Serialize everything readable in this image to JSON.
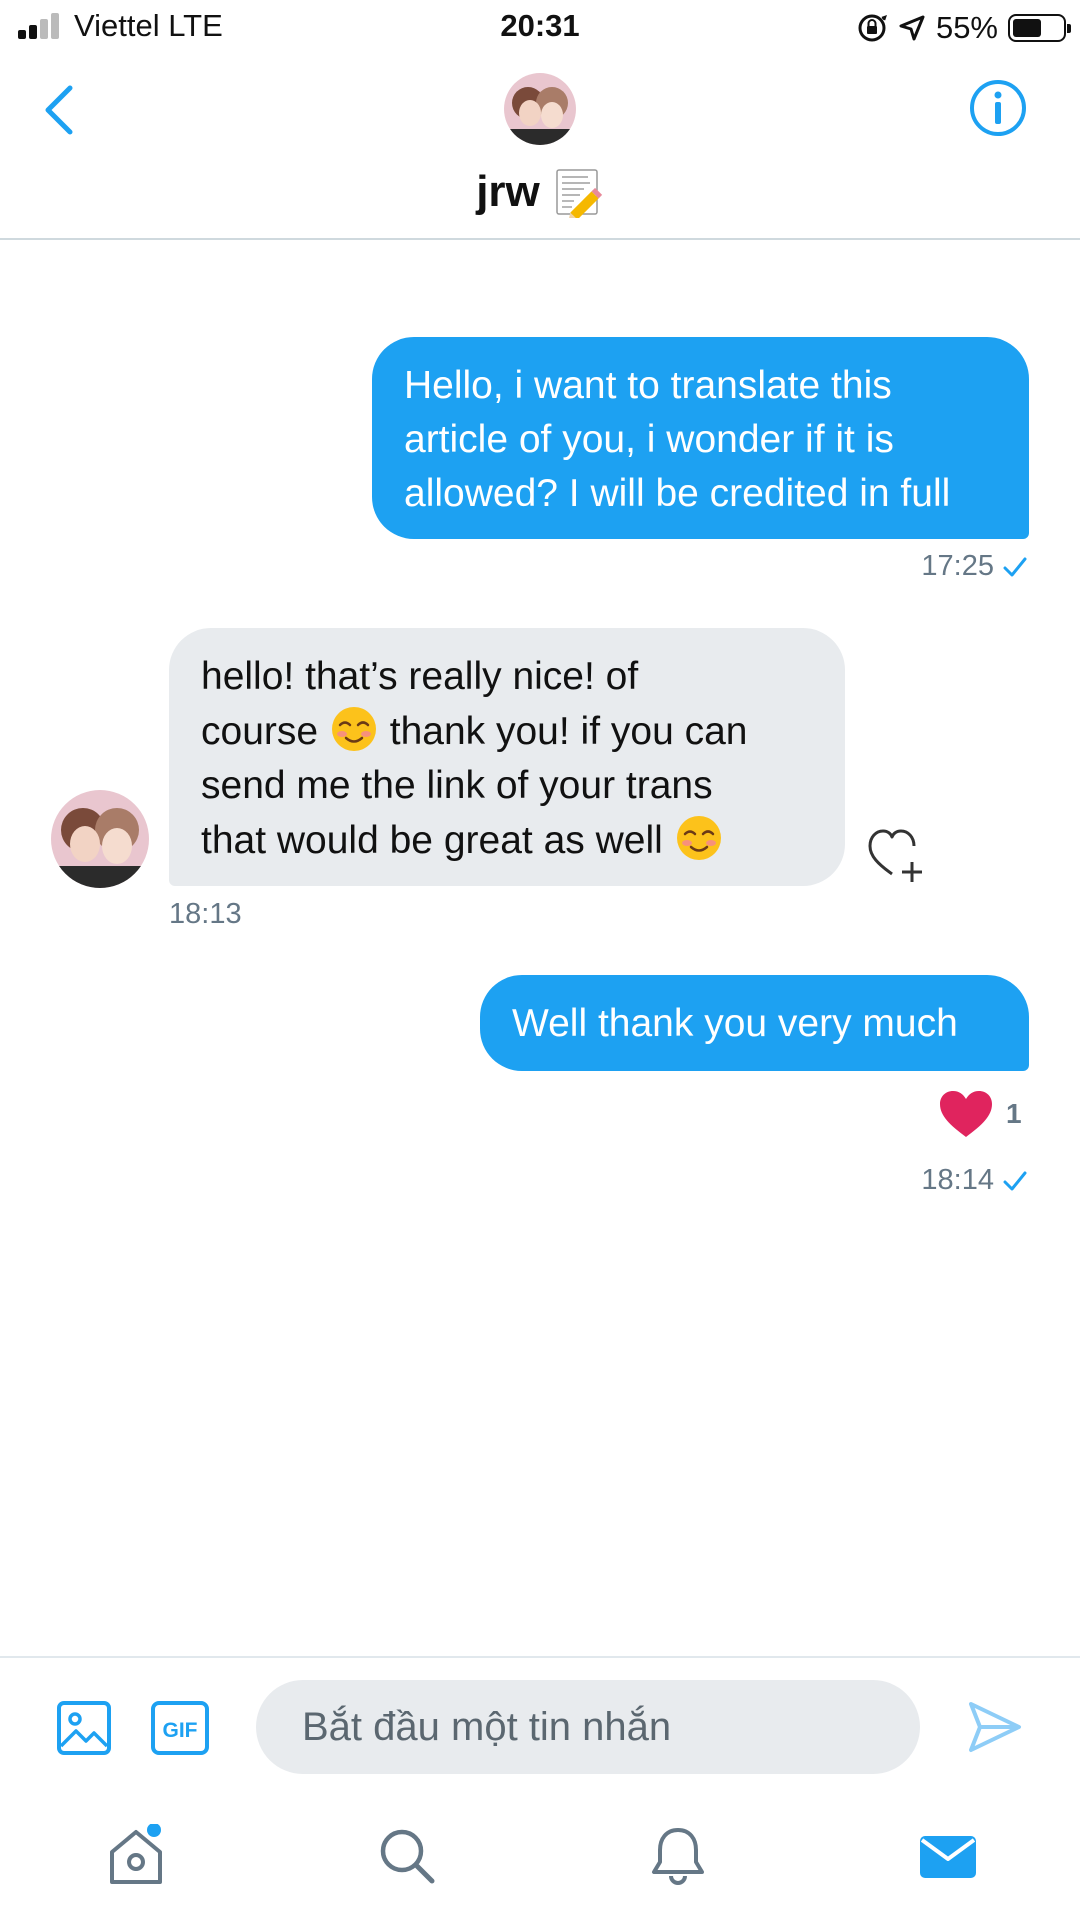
{
  "status_bar": {
    "carrier": "Viettel  LTE",
    "time": "20:31",
    "battery": "55%",
    "icons": [
      "signal-icon",
      "rotation-lock-icon",
      "location-icon",
      "battery-icon"
    ]
  },
  "header": {
    "name": "jrw",
    "name_emoji": "memo-icon",
    "back_icon": "chevron-left-icon",
    "info_icon": "info-icon"
  },
  "messages": [
    {
      "direction": "outgoing",
      "lines": [
        "Hello, i want to translate this",
        "article of you, i wonder if it is",
        "allowed? I will be credited in full"
      ],
      "time": "17:25",
      "status": "sent"
    },
    {
      "direction": "incoming",
      "lines": [
        "hello! that’s really nice! of",
        "course",
        "thank you! if you can",
        "send me the link of your trans",
        "that would be great as well"
      ],
      "inline_emoji": "smiling-face-icon",
      "time": "18:13"
    },
    {
      "direction": "outgoing",
      "text": "Well thank you very much",
      "reaction": {
        "icon": "heart-icon",
        "count": "1"
      },
      "time": "18:14",
      "status": "sent"
    }
  ],
  "composer": {
    "placeholder": "Bắt đầu một tin nhắn",
    "value": "",
    "gif_label": "GIF"
  },
  "tabs": [
    "home",
    "search",
    "notifications",
    "messages"
  ],
  "colors": {
    "accent": "#1da1f2",
    "incoming_bubble": "#e8ebee",
    "meta_text": "#657786",
    "heart": "#e0245e"
  }
}
